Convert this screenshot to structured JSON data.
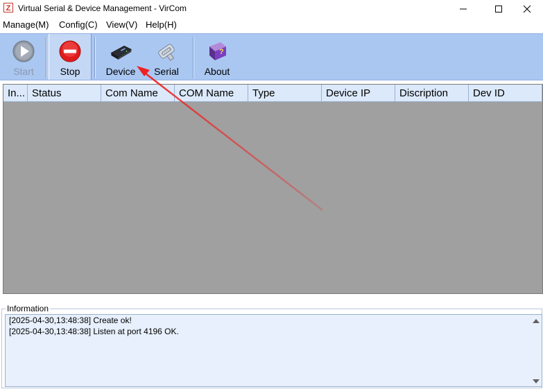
{
  "window": {
    "title": "Virtual Serial & Device Management - VirCom",
    "app_icon_letter": "Z"
  },
  "menu": [
    "Manage(M)",
    "Config(C)",
    "View(V)",
    "Help(H)"
  ],
  "toolbar": {
    "start": "Start",
    "stop": "Stop",
    "device": "Device",
    "serial": "Serial",
    "about": "About"
  },
  "table": {
    "columns": [
      "In...",
      "Status",
      "Com Name",
      "COM Name",
      "Type",
      "Device IP",
      "Discription",
      "Dev ID"
    ],
    "rows": []
  },
  "info": {
    "label": "Information",
    "lines": [
      "[2025-04-30,13:48:38] Create ok!",
      "[2025-04-30,13:48:38] Listen at port 4196 OK."
    ]
  },
  "colors": {
    "toolbar_bg": "#aac7f1",
    "table_bg": "#a0a0a0",
    "header_bg": "#dce9fb",
    "annotation_arrow": "#ee2222"
  }
}
